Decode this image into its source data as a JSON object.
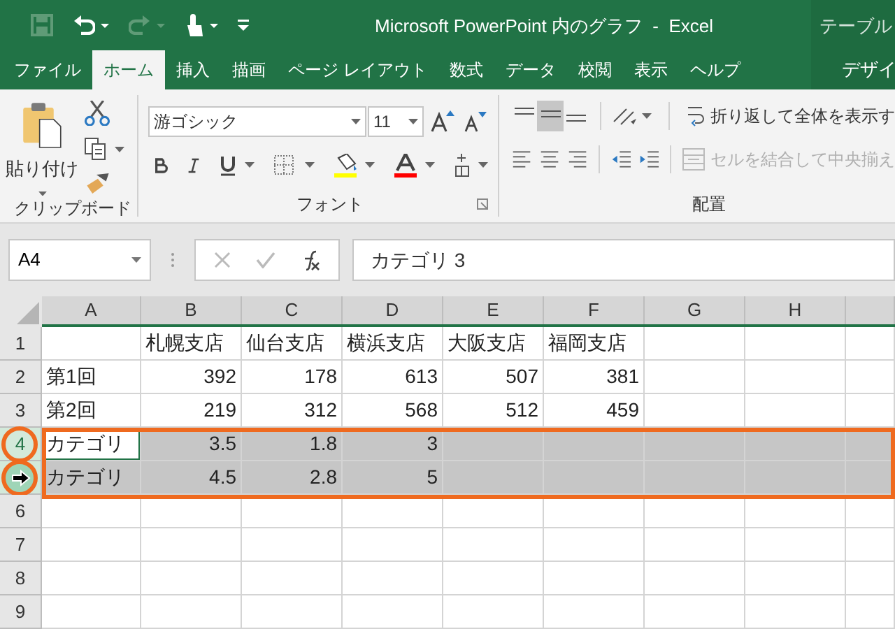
{
  "title_bar": {
    "quick_access": [
      {
        "kind": "save",
        "disabled": true
      },
      {
        "kind": "undo",
        "disabled": false
      },
      {
        "kind": "redo",
        "disabled": true
      },
      {
        "kind": "touch",
        "disabled": false
      },
      {
        "kind": "customize",
        "disabled": false
      }
    ],
    "title": "Microsoft PowerPoint 内のグラフ  -  Excel",
    "context_group": "テーブル"
  },
  "ribbon_tabs": [
    {
      "label": "ファイル",
      "selected": false,
      "kind": "normal"
    },
    {
      "label": "ホーム",
      "selected": true,
      "kind": "normal"
    },
    {
      "label": "挿入",
      "selected": false,
      "kind": "normal"
    },
    {
      "label": "描画",
      "selected": false,
      "kind": "normal"
    },
    {
      "label": "ページ レイアウト",
      "selected": false,
      "kind": "normal"
    },
    {
      "label": "数式",
      "selected": false,
      "kind": "normal"
    },
    {
      "label": "データ",
      "selected": false,
      "kind": "normal"
    },
    {
      "label": "校閲",
      "selected": false,
      "kind": "normal"
    },
    {
      "label": "表示",
      "selected": false,
      "kind": "normal"
    },
    {
      "label": "ヘルプ",
      "selected": false,
      "kind": "normal"
    },
    {
      "label": "デザイ",
      "selected": false,
      "kind": "contextual"
    }
  ],
  "ribbon": {
    "clipboard": {
      "paste_label": "貼り付け",
      "group_label": "クリップボード"
    },
    "font": {
      "font_name": "游ゴシック",
      "font_size": "11",
      "group_label": "フォント"
    },
    "alignment": {
      "vertical_align": [
        {
          "kind": "top",
          "selected": false
        },
        {
          "kind": "middle",
          "selected": true
        },
        {
          "kind": "bottom",
          "selected": false
        }
      ],
      "wrap_text": {
        "label": "折り返して全体を表示す",
        "disabled": false
      },
      "merge": {
        "label": "セルを結合して中央揃え",
        "disabled": true
      },
      "group_label": "配置"
    }
  },
  "formula_bar": {
    "name_box": "A4",
    "content": "カテゴリ 3"
  },
  "sheet": {
    "columns": [
      "A",
      "B",
      "C",
      "D",
      "E",
      "F",
      "G",
      "H"
    ],
    "highlight_box": true,
    "rows": [
      {
        "label": "1",
        "selected": false,
        "circled": false,
        "pointer_cursor": false,
        "cells": [
          null,
          {
            "text": "札幌支店",
            "kind": "text",
            "active": false
          },
          {
            "text": "仙台支店",
            "kind": "text",
            "active": false
          },
          {
            "text": "横浜支店",
            "kind": "text",
            "active": false
          },
          {
            "text": "大阪支店",
            "kind": "text",
            "active": false
          },
          {
            "text": "福岡支店",
            "kind": "text",
            "active": false
          }
        ]
      },
      {
        "label": "2",
        "selected": false,
        "circled": false,
        "pointer_cursor": false,
        "cells": [
          {
            "text": "第1回",
            "kind": "text",
            "active": false
          },
          {
            "text": "392",
            "kind": "number",
            "active": false
          },
          {
            "text": "178",
            "kind": "number",
            "active": false
          },
          {
            "text": "613",
            "kind": "number",
            "active": false
          },
          {
            "text": "507",
            "kind": "number",
            "active": false
          },
          {
            "text": "381",
            "kind": "number",
            "active": false
          }
        ]
      },
      {
        "label": "3",
        "selected": false,
        "circled": false,
        "pointer_cursor": false,
        "cells": [
          {
            "text": "第2回",
            "kind": "text",
            "active": false
          },
          {
            "text": "219",
            "kind": "number",
            "active": false
          },
          {
            "text": "312",
            "kind": "number",
            "active": false
          },
          {
            "text": "568",
            "kind": "number",
            "active": false
          },
          {
            "text": "512",
            "kind": "number",
            "active": false
          },
          {
            "text": "459",
            "kind": "number",
            "active": false
          }
        ]
      },
      {
        "label": "4",
        "selected": true,
        "circled": true,
        "pointer_cursor": false,
        "cells": [
          {
            "text": "カテゴリ",
            "kind": "text",
            "active": true
          },
          {
            "text": "3.5",
            "kind": "number",
            "active": false
          },
          {
            "text": "1.8",
            "kind": "number",
            "active": false
          },
          {
            "text": "3",
            "kind": "number",
            "active": false
          }
        ]
      },
      {
        "selected": true,
        "circled": true,
        "pointer_cursor": true,
        "cells": [
          {
            "text": "カテゴリ",
            "kind": "text",
            "active": false
          },
          {
            "text": "4.5",
            "kind": "number",
            "active": false
          },
          {
            "text": "2.8",
            "kind": "number",
            "active": false
          },
          {
            "text": "5",
            "kind": "number",
            "active": false
          }
        ]
      },
      {
        "label": "6",
        "selected": false,
        "circled": false,
        "pointer_cursor": false,
        "cells": []
      },
      {
        "label": "7",
        "selected": false,
        "circled": false,
        "pointer_cursor": false,
        "cells": []
      },
      {
        "label": "8",
        "selected": false,
        "circled": false,
        "pointer_cursor": false,
        "cells": []
      },
      {
        "label": "9",
        "selected": false,
        "circled": false,
        "pointer_cursor": false,
        "cells": []
      }
    ]
  }
}
